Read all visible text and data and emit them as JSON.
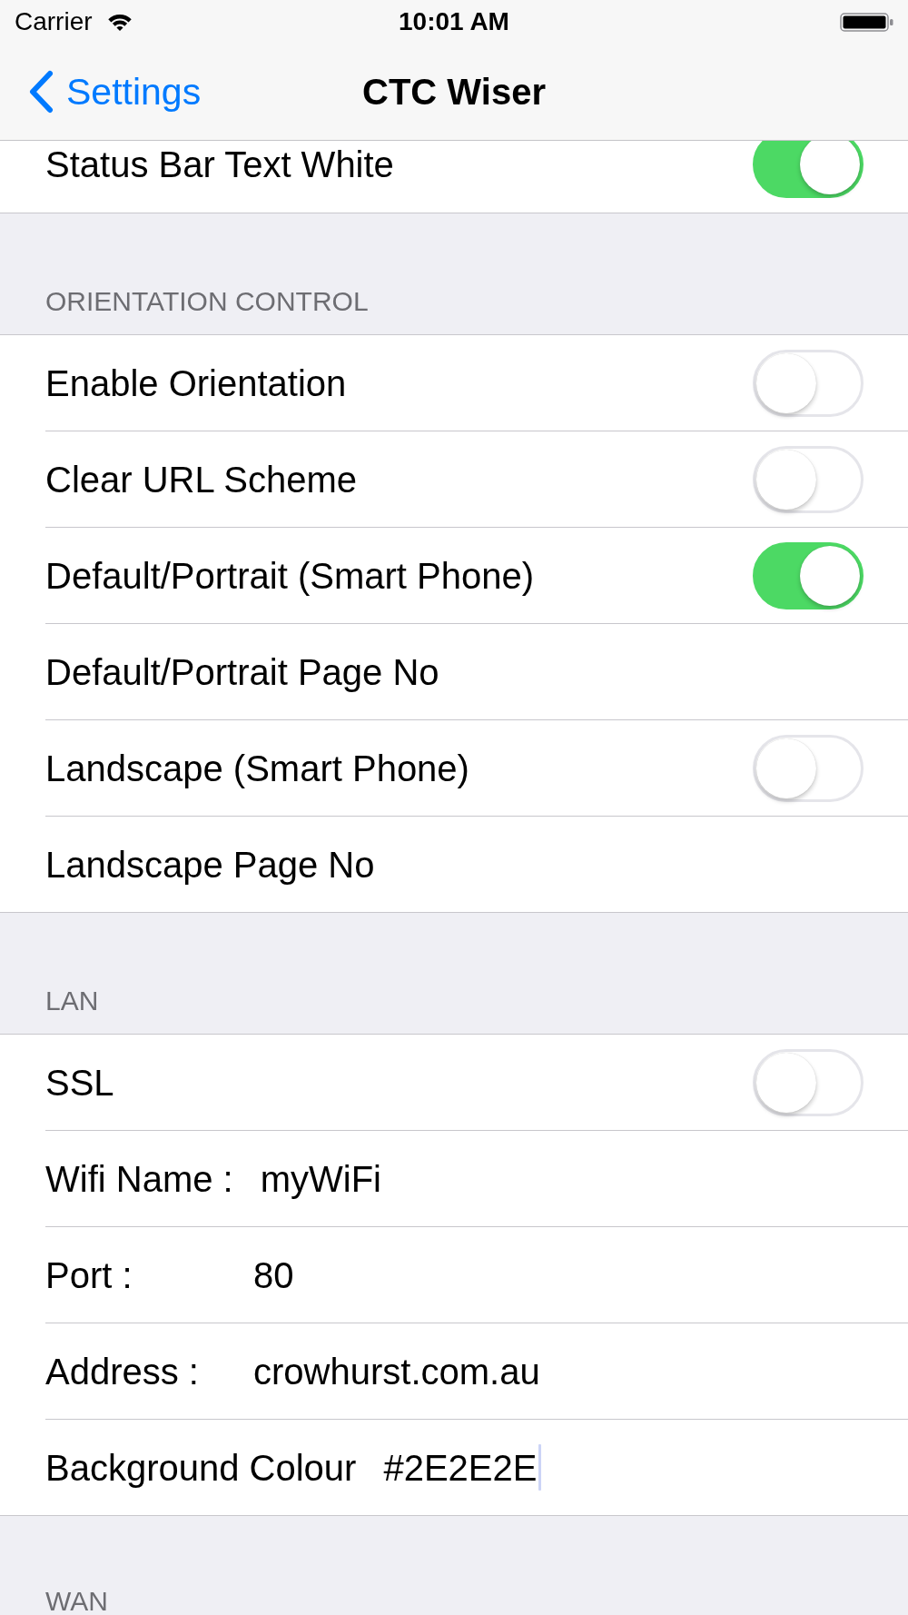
{
  "status_bar": {
    "carrier": "Carrier",
    "time": "10:01 AM"
  },
  "nav_bar": {
    "back_label": "Settings",
    "title": "CTC Wiser"
  },
  "sections": [
    {
      "rows": [
        {
          "kind": "toggle",
          "label": "Status Bar Text White",
          "on": true
        }
      ]
    },
    {
      "header": "ORIENTATION CONTROL",
      "rows": [
        {
          "kind": "toggle",
          "label": "Enable Orientation",
          "on": false
        },
        {
          "kind": "toggle",
          "label": "Clear URL Scheme",
          "on": false
        },
        {
          "kind": "toggle",
          "label": "Default/Portrait (Smart Phone)",
          "on": true
        },
        {
          "kind": "text",
          "label": "Default/Portrait Page No"
        },
        {
          "kind": "toggle",
          "label": "Landscape (Smart Phone)",
          "on": false
        },
        {
          "kind": "text",
          "label": "Landscape Page No"
        }
      ]
    },
    {
      "header": "LAN",
      "rows": [
        {
          "kind": "toggle",
          "label": "SSL",
          "on": false
        },
        {
          "kind": "field",
          "label": "Wifi Name :",
          "value": "myWiFi",
          "focused": false
        },
        {
          "kind": "field",
          "label": "Port :",
          "value": "80",
          "focused": false
        },
        {
          "kind": "field",
          "label": "Address :",
          "value": "crowhurst.com.au",
          "focused": false
        },
        {
          "kind": "field",
          "label": "Background Colour",
          "value": "#2E2E2E",
          "focused": true
        }
      ]
    },
    {
      "header": "WAN"
    }
  ]
}
